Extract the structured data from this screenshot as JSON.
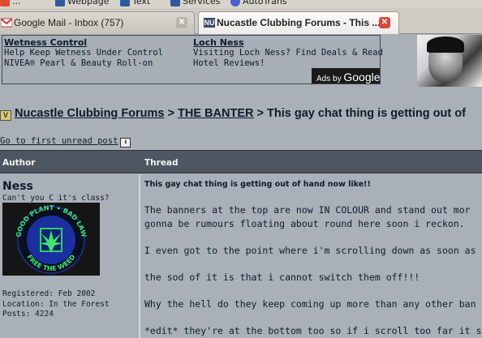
{
  "browser": {
    "bookmarks": [
      {
        "label": "...",
        "icon": "bookmark-icon"
      },
      {
        "label": "Webpage",
        "icon": "webpage-icon"
      },
      {
        "label": "Text",
        "icon": "text-icon"
      },
      {
        "label": "Services",
        "icon": "services-icon"
      },
      {
        "label": "AutoTrans",
        "icon": "autotrans-icon"
      }
    ],
    "tabs": [
      {
        "title": "Google Mail - Inbox (757)",
        "icon": "gmail-icon",
        "active": false
      },
      {
        "title": "Nucastle Clubbing Forums - This ...",
        "icon": "nu-favicon-icon",
        "favicon_text": "NU",
        "active": true
      }
    ]
  },
  "ads": {
    "left": {
      "title": "Wetness Control",
      "line1": "Help Keep Wetness Under Control",
      "line2": "NIVEA® Pearl & Beauty Roll-on"
    },
    "right": {
      "title": "Loch Ness",
      "line1": "Visiting Loch Ness? Find Deals & Read",
      "line2": "Hotel Reviews!"
    },
    "ads_by": "Ads by",
    "google": "Google"
  },
  "breadcrumb": {
    "forum": "Nucastle Clubbing Forums",
    "sep1": " > ",
    "section": "THE BANTER",
    "sep2": " > ",
    "thread": "This gay chat thing is getting out of"
  },
  "unread_link": "Go to first unread post",
  "table": {
    "author_header": "Author",
    "thread_header": "Thread"
  },
  "post": {
    "author": "Ness",
    "author_title": "Can't you C it's class?",
    "avatar_text_top": "GOOD PLANT • BAD LAW",
    "avatar_text_bottom": "FREE THE WEED",
    "registered": "Registered: Feb 2002",
    "location": "Location: In the Forest",
    "posts": "Posts: 4224",
    "title": "This gay chat thing is getting out of hand now like!!",
    "body": "The banners at the top are now IN COLOUR and stand out mor\ngonna be rumours floating about round here soon i reckon.\n\nI even got to the point where i'm scrolling down as soon as the\n\nthe sod of it is that i cannot switch them off!!!\n\nWhy the hell do they keep coming up more than any other ban\n\n*edit* they're at the bottom too so if i scroll too far it shows!"
  },
  "colors": {
    "page_bg": "#a9b0b8",
    "header_bar": "#4d5661",
    "text": "#0e1c2c",
    "close_red": "#d9473a"
  }
}
